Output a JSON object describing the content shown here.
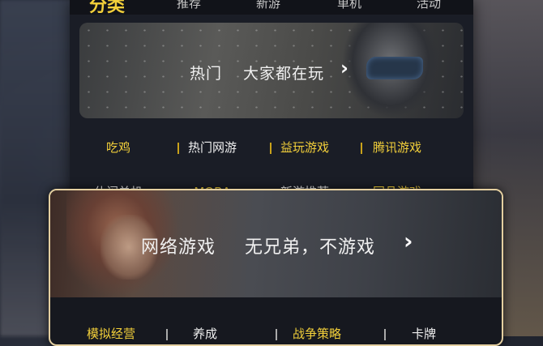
{
  "nav": {
    "tabs": [
      "分类",
      "推荐",
      "新游",
      "单机",
      "活动"
    ],
    "active_index": 0
  },
  "banner1": {
    "title": "热门",
    "subtitle": "大家都在玩",
    "chevron": "›"
  },
  "categories_row1": [
    "吃鸡",
    "热门网游",
    "益玩游戏",
    "腾讯游戏"
  ],
  "categories_row2_partial": [
    "休闲单机",
    "MOBA",
    "新游推荐",
    "同品游戏"
  ],
  "card": {
    "title": "网络游戏",
    "subtitle": "无兄弟，不游戏",
    "chevron": "›",
    "categories": [
      "模拟经营",
      "养成",
      "战争策略",
      "卡牌"
    ]
  },
  "colors": {
    "accent_yellow": "#f2cf3a",
    "text_white": "#f0f0f0",
    "panel_bg": "#1a1d26",
    "card_border": "#e4cfa0"
  }
}
